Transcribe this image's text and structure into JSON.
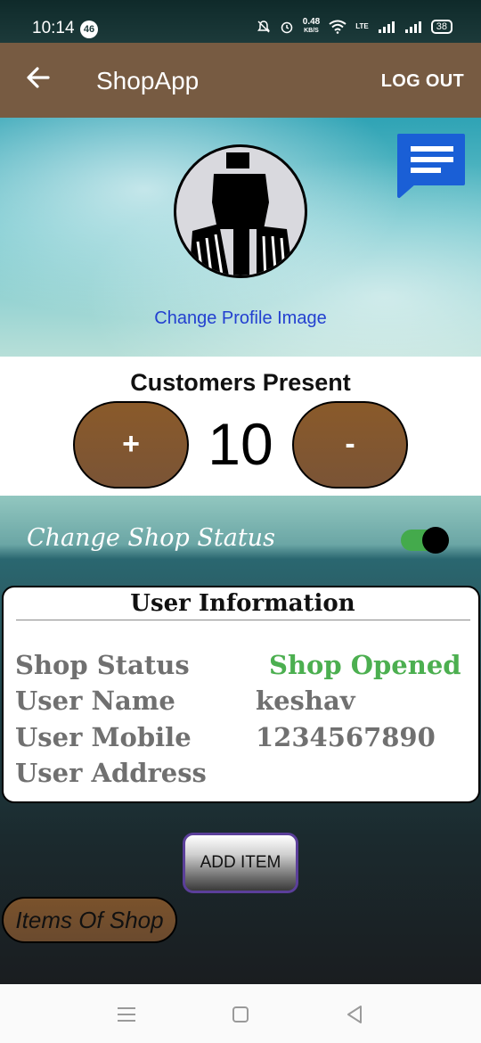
{
  "status_bar": {
    "time": "10:14",
    "notification_count": "46",
    "net_speed": "0.48",
    "net_speed_unit": "KB/S",
    "network_type": "LTE",
    "battery": "38"
  },
  "app_bar": {
    "title": "ShopApp",
    "logout_label": "LOG OUT",
    "back_icon": "arrow-left-icon"
  },
  "profile": {
    "change_image_label": "Change Profile Image",
    "chat_icon": "chat-message-icon"
  },
  "customers": {
    "label": "Customers Present",
    "count": "10",
    "increment_label": "+",
    "decrement_label": "-"
  },
  "shop_status_toggle": {
    "label": "Change Shop Status",
    "checked": true
  },
  "user_info": {
    "title": "User Information",
    "rows": [
      {
        "label": "Shop Status",
        "value": "Shop Opened"
      },
      {
        "label": "User Name",
        "value": "keshav"
      },
      {
        "label": "User Mobile",
        "value": "1234567890"
      },
      {
        "label": "User Address",
        "value": ""
      }
    ]
  },
  "actions": {
    "add_item_label": "ADD ITEM",
    "items_of_shop_label": "Items Of Shop"
  },
  "colors": {
    "app_bar": "#775b42",
    "pill_brown": "#8a5a2a",
    "status_green": "#4caf50",
    "link_blue": "#2340d0"
  }
}
